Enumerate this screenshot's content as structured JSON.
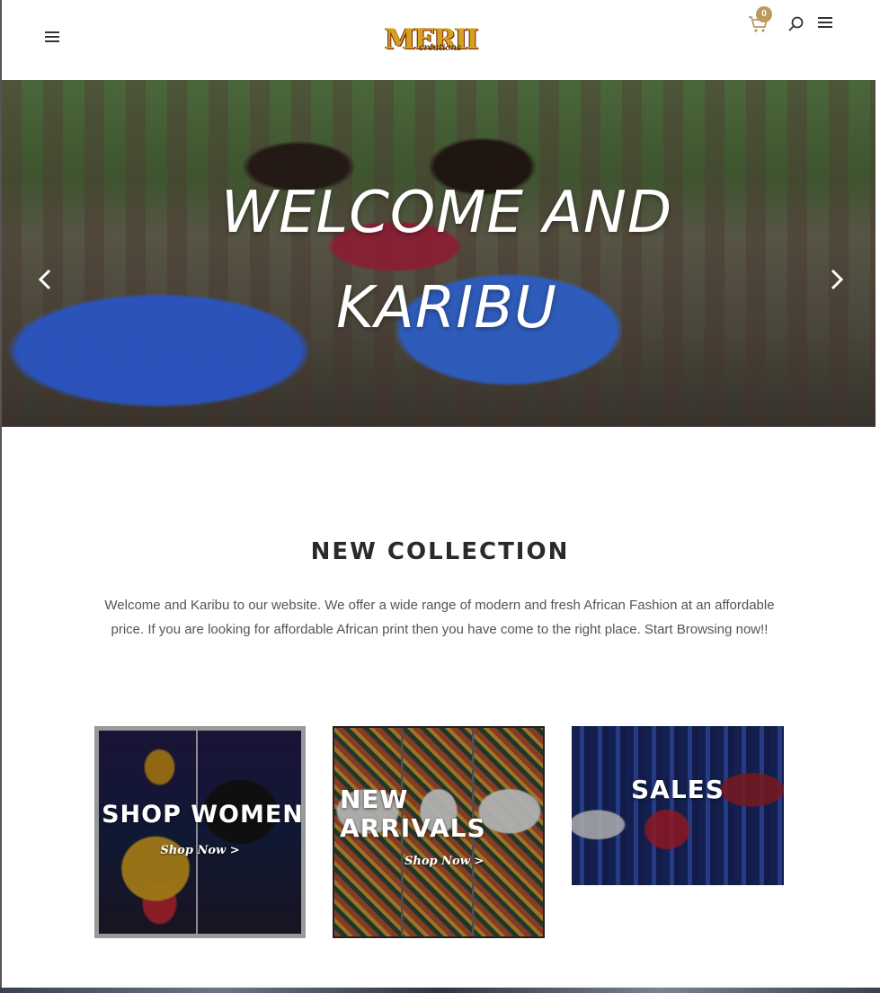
{
  "header": {
    "logo_text": "MERII",
    "logo_subtext": "creations",
    "cart_count": "0"
  },
  "hero": {
    "title_line1": "WELCOME AND",
    "title_line2": "KARIBU"
  },
  "intro": {
    "title": "NEW COLLECTION",
    "body": "Welcome and Karibu to our website. We offer a wide range of modern and fresh African Fashion at an affordable price. If you are looking for affordable African print then you have come to the right place. Start Browsing now!!"
  },
  "categories": [
    {
      "title": "SHOP WOMEN",
      "link": "Shop Now >"
    },
    {
      "title_line1": "NEW",
      "title_line2": "ARRIVALS",
      "link": "Shop Now >"
    },
    {
      "title": "SALES"
    }
  ],
  "colors": {
    "accent_gold": "#b99a5b",
    "heading_dark": "#2a2a2a",
    "body_text": "#555555"
  },
  "icons": [
    "menu-icon",
    "cart-icon",
    "search-icon",
    "chevron-left-icon",
    "chevron-right-icon"
  ]
}
